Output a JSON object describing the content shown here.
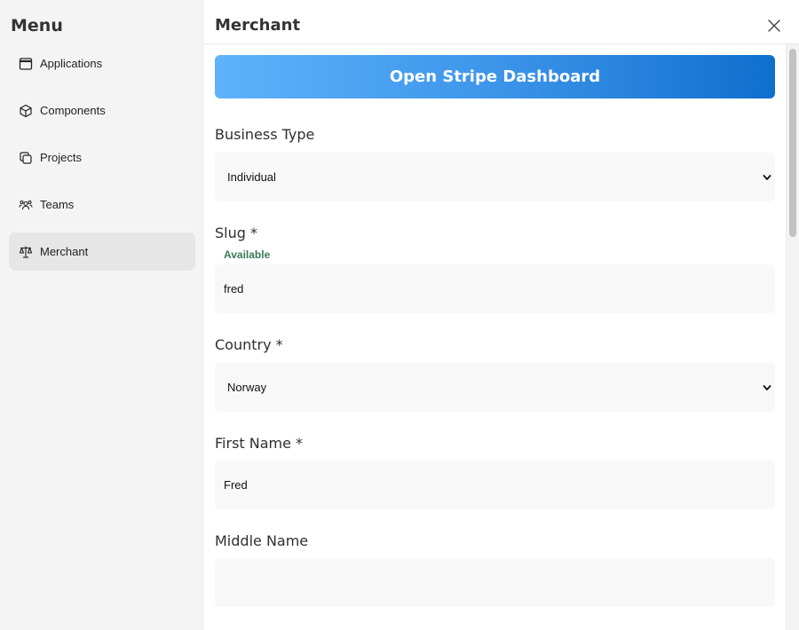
{
  "sidebar": {
    "title": "Menu",
    "items": [
      {
        "label": "Applications",
        "icon": "window-icon",
        "active": false
      },
      {
        "label": "Components",
        "icon": "cube-icon",
        "active": false
      },
      {
        "label": "Projects",
        "icon": "copy-icon",
        "active": false
      },
      {
        "label": "Teams",
        "icon": "users-icon",
        "active": false
      },
      {
        "label": "Merchant",
        "icon": "scale-icon",
        "active": true
      }
    ]
  },
  "header": {
    "title": "Merchant",
    "close_icon": "close-icon"
  },
  "form": {
    "stripe_button": "Open Stripe Dashboard",
    "business_type": {
      "label": "Business Type",
      "value": "Individual"
    },
    "slug": {
      "label": "Slug *",
      "status": "Available",
      "value": "fred"
    },
    "country": {
      "label": "Country *",
      "value": "Norway"
    },
    "first_name": {
      "label": "First Name *",
      "value": "Fred"
    },
    "middle_name": {
      "label": "Middle Name",
      "value": ""
    }
  },
  "colors": {
    "accent_start": "#5eb3fa",
    "accent_end": "#0f6fcd",
    "available": "#3a7a58"
  }
}
